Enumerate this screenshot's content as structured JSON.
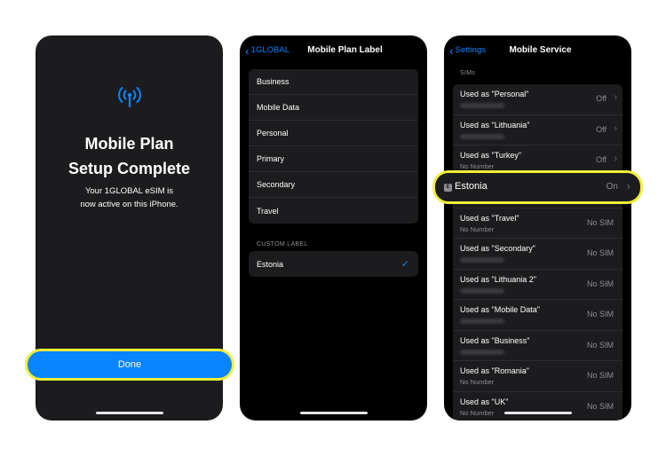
{
  "screen1": {
    "title_line1": "Mobile Plan",
    "title_line2": "Setup Complete",
    "body_line1": "Your 1GLOBAL eSIM is",
    "body_line2": "now active on this iPhone.",
    "done_label": "Done",
    "icon": "antenna-signal-icon"
  },
  "screen2": {
    "back_label": "1GLOBAL",
    "title": "Mobile Plan Label",
    "labels": [
      "Business",
      "Mobile Data",
      "Personal",
      "Primary",
      "Secondary",
      "Travel"
    ],
    "custom_section": "CUSTOM LABEL",
    "custom_value": "Estonia",
    "selected_icon": "checkmark-icon"
  },
  "screen3": {
    "back_label": "Settings",
    "title": "Mobile Service",
    "section": "SIMs",
    "sims_top": [
      {
        "name": "Used as \"Personal\"",
        "sub": "",
        "status": "Off"
      },
      {
        "name": "Used as \"Lithuania\"",
        "sub": "",
        "status": "Off"
      },
      {
        "name": "Used as \"Turkey\"",
        "sub": "No Number",
        "status": "Off"
      }
    ],
    "highlight": {
      "badge": "E",
      "name": "Estonia",
      "status": "On"
    },
    "sims_bottom": [
      {
        "name": "Used as \"Travel\"",
        "sub": "No Number",
        "status": "No SIM"
      },
      {
        "name": "Used as \"Secondary\"",
        "sub": "",
        "status": "No SIM"
      },
      {
        "name": "Used as \"Lithuania 2\"",
        "sub": "",
        "status": "No SIM"
      },
      {
        "name": "Used as \"Mobile Data\"",
        "sub": "",
        "status": "No SIM"
      },
      {
        "name": "Used as \"Business\"",
        "sub": "",
        "status": "No SIM"
      },
      {
        "name": "Used as \"Romania\"",
        "sub": "No Number",
        "status": "No SIM"
      },
      {
        "name": "Used as \"UK\"",
        "sub": "No Number",
        "status": "No SIM"
      }
    ]
  },
  "colors": {
    "accent": "#0a84ff",
    "highlight": "#f2ee3a",
    "background": "#1c1c1e"
  }
}
